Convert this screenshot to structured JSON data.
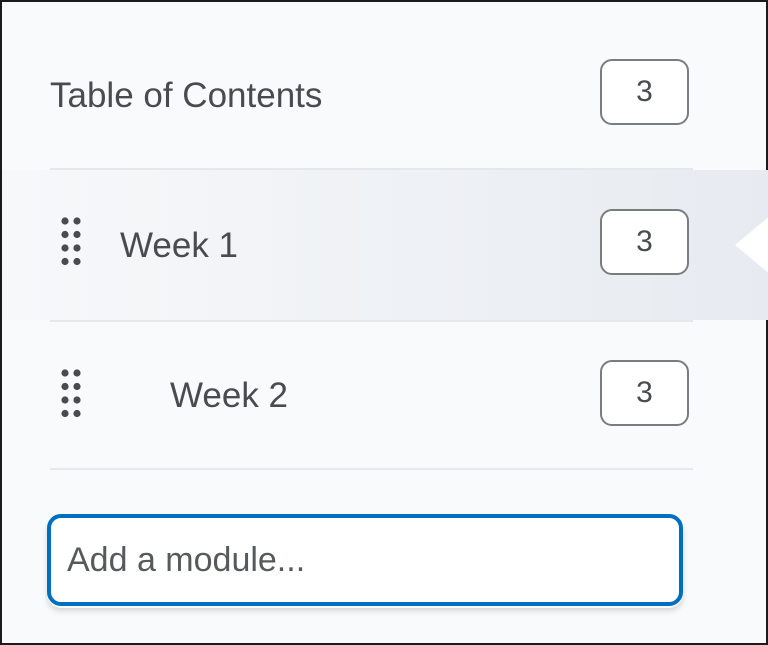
{
  "toc": {
    "title": "Table of Contents",
    "count": "3"
  },
  "modules": [
    {
      "label": "Week 1",
      "count": "3",
      "selected": true
    },
    {
      "label": "Week 2",
      "count": "3",
      "selected": false
    }
  ],
  "add_module": {
    "placeholder": "Add a module..."
  },
  "colors": {
    "text": "#494c4e",
    "divider": "#e4e8ee",
    "input_focus_border": "#006fbf",
    "selected_band": "#e7ebf1"
  },
  "icons": {
    "drag_handle": "drag-handle-icon",
    "selected_indicator": "caret-left-icon"
  }
}
